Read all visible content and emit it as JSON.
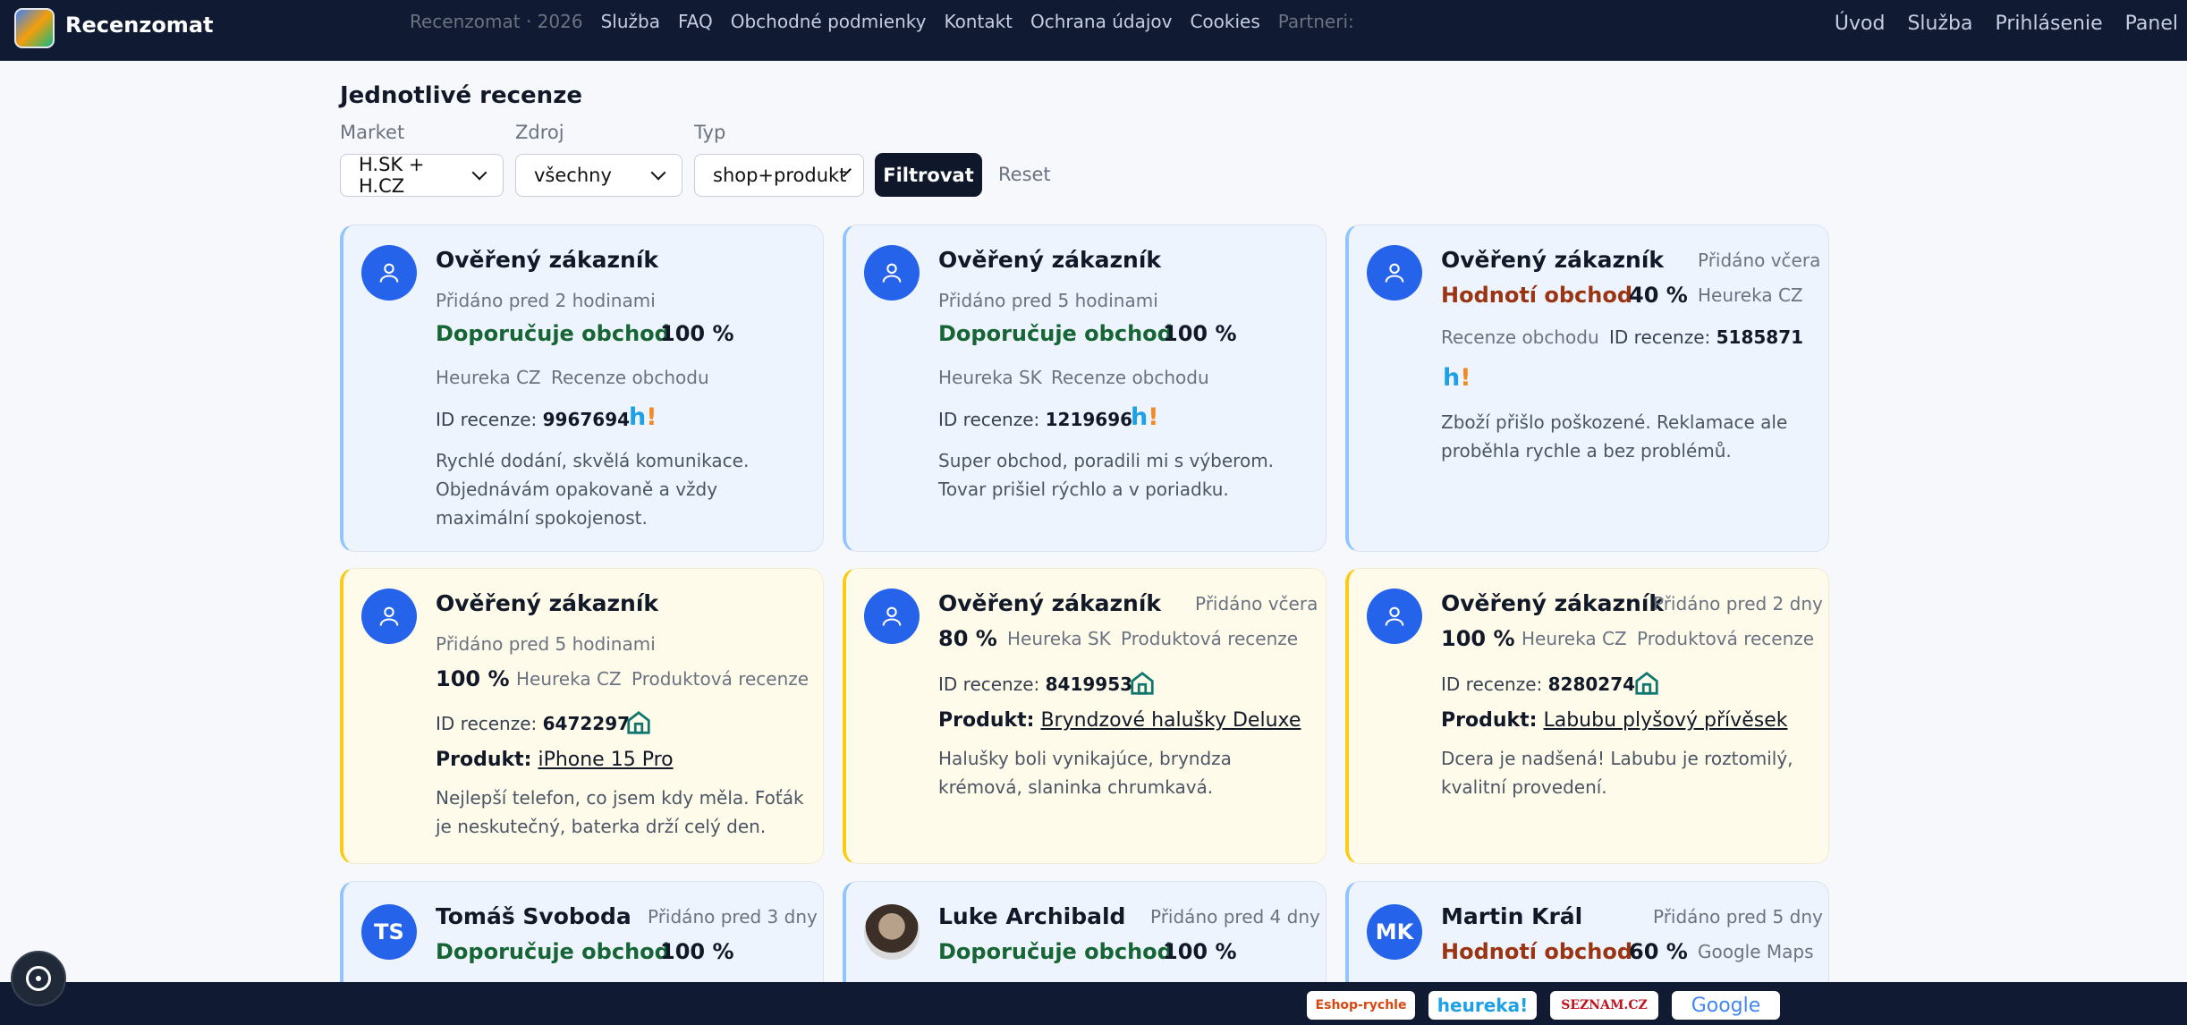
{
  "header": {
    "brand": "Recenzomat",
    "nav": [
      "Úvod",
      "Služba",
      "Prihlásenie",
      "Panel"
    ]
  },
  "page_title": "Jednotlivé recenze",
  "filters": {
    "market_label": "Market",
    "market_value": "H.SK + H.CZ",
    "source_label": "Zdroj",
    "source_value": "všechny",
    "type_label": "Typ",
    "type_value": "shop+produkt",
    "filter_button": "Filtrovat",
    "reset_button": "Reset"
  },
  "id_label": "ID recenze:",
  "product_label": "Produkt:",
  "reviews": [
    {
      "name": "Ověřený zákazník",
      "date": "Přidáno pred 2 hodinami",
      "verdict": "Doporučuje obchod",
      "pct": "100 %",
      "source": "Heureka CZ",
      "kind": "Recenze obchodu",
      "id": "9967694",
      "text": "Rychlé dodání, skvělá komunikace. Objednávám opakovaně a vždy maximální spokojenost."
    },
    {
      "name": "Ověřený zákazník",
      "date": "Přidáno pred 5 hodinami",
      "verdict": "Doporučuje obchod",
      "pct": "100 %",
      "source": "Heureka SK",
      "kind": "Recenze obchodu",
      "id": "1219696",
      "text": "Super obchod, poradili mi s výberom. Tovar prišiel rýchlo a v poriadku."
    },
    {
      "name": "Ověřený zákazník",
      "date": "Přidáno včera",
      "verdict": "Hodnotí obchod",
      "pct": "40 %",
      "source": "Heureka CZ",
      "kind": "Recenze obchodu",
      "id": "5185871",
      "text": "Zboží přišlo poškozené. Reklamace ale proběhla rychle a bez problémů."
    },
    {
      "name": "Ověřený zákazník",
      "date": "Přidáno pred 5 hodinami",
      "pct": "100 %",
      "source": "Heureka CZ",
      "kind": "Produktová recenze",
      "id": "6472297",
      "product": "iPhone 15 Pro",
      "text": "Nejlepší telefon, co jsem kdy měla. Foťák je neskutečný, baterka drží celý den."
    },
    {
      "name": "Ověřený zákazník",
      "date": "Přidáno včera",
      "pct": "80 %",
      "source": "Heureka SK",
      "kind": "Produktová recenze",
      "id": "8419953",
      "product": "Bryndzové halušky Deluxe",
      "text": "Halušky boli vynikajúce, bryndza krémová, slaninka chrumkavá."
    },
    {
      "name": "Ověřený zákazník",
      "date": "Přidáno pred 2 dny",
      "pct": "100 %",
      "source": "Heureka CZ",
      "kind": "Produktová recenze",
      "id": "8280274",
      "product": "Labubu plyšový přívěsek",
      "text": "Dcera je nadšená! Labubu je roztomilý, kvalitní provedení."
    },
    {
      "name": "Tomáš Svoboda",
      "initials": "TS",
      "date": "Přidáno pred 3 dny",
      "verdict": "Doporučuje obchod",
      "pct": "100 %"
    },
    {
      "name": "Luke Archibald",
      "date": "Přidáno pred 4 dny",
      "verdict": "Doporučuje obchod",
      "pct": "100 %"
    },
    {
      "name": "Martin Král",
      "initials": "MK",
      "date": "Přidáno pred 5 dny",
      "verdict": "Hodnotí obchod",
      "pct": "60 %",
      "source": "Google Maps"
    }
  ],
  "footer": {
    "copyright": "Recenzomat · 2026",
    "links": [
      "Služba",
      "FAQ",
      "Obchodné podmienky",
      "Kontakt",
      "Ochrana údajov",
      "Cookies"
    ],
    "partners_label": "Partneri:",
    "partners": [
      "Eshop-rychle",
      "heureka!",
      "SEZNAM.CZ",
      "Google"
    ]
  }
}
